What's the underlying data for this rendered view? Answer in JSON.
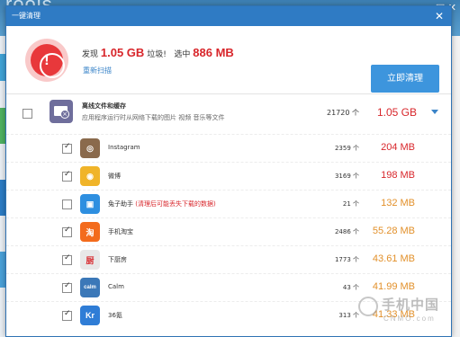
{
  "background": {
    "title": "roois",
    "window_buttons": "— □ ✕"
  },
  "dialog": {
    "title": "一键清理",
    "close_glyph": "✕"
  },
  "summary": {
    "found_label": "发现",
    "found_size": "1.05 GB",
    "junk_label": "垃圾!",
    "selected_label": "选中",
    "selected_size": "886 MB",
    "rescan_label": "重新扫描",
    "clean_button": "立即清理",
    "alert_glyph": "!"
  },
  "category": {
    "name": "离线文件和缓存",
    "description": "应用程序运行时从网络下载的图片 视频 音乐等文件",
    "count": "21720 个",
    "size": "1.05 GB",
    "checked": false
  },
  "items": [
    {
      "name": "Instagram",
      "warning": "",
      "count": "2359 个",
      "size": "204 MB",
      "checked": true,
      "icon": "instagram-icon",
      "icon_glyph": "◎",
      "icon_color": "#8a6a4c",
      "size_color": "red"
    },
    {
      "name": "微博",
      "warning": "",
      "count": "3169 个",
      "size": "198 MB",
      "checked": true,
      "icon": "weibo-icon",
      "icon_glyph": "◉",
      "icon_color": "#f0b429",
      "size_color": "red"
    },
    {
      "name": "兔子助手",
      "warning": "(清理后可能丢失下载的数据)",
      "count": "21 个",
      "size": "132 MB",
      "checked": false,
      "icon": "tuzi-icon",
      "icon_glyph": "▣",
      "icon_color": "#2e8fe0",
      "size_color": "orange"
    },
    {
      "name": "手机淘宝",
      "warning": "",
      "count": "2486 个",
      "size": "55.28 MB",
      "checked": true,
      "icon": "taobao-icon",
      "icon_glyph": "淘",
      "icon_color": "#f36b1c",
      "size_color": "orange"
    },
    {
      "name": "下厨房",
      "warning": "",
      "count": "1773 个",
      "size": "43.61 MB",
      "checked": true,
      "icon": "xiachufang-icon",
      "icon_glyph": "厨",
      "icon_color": "#e8e8e8",
      "size_color": "orange"
    },
    {
      "name": "Calm",
      "warning": "",
      "count": "43 个",
      "size": "41.99 MB",
      "checked": true,
      "icon": "calm-icon",
      "icon_glyph": "calm",
      "icon_color": "#3b78b8",
      "size_color": "orange"
    },
    {
      "name": "36氪",
      "warning": "",
      "count": "313 个",
      "size": "41.33 MB",
      "checked": true,
      "icon": "36kr-icon",
      "icon_glyph": "Kr",
      "icon_color": "#2f7dd6",
      "size_color": "orange"
    }
  ],
  "watermark": {
    "text": "手机中国",
    "sub": "CNMO.com"
  }
}
